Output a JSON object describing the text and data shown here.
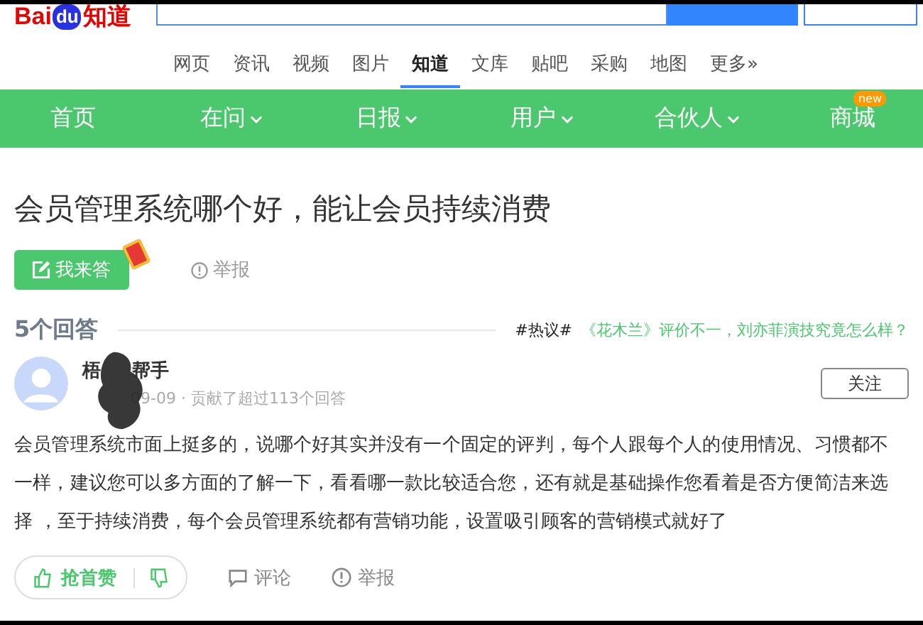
{
  "header": {
    "logo": {
      "part_1": "Bai",
      "part_2": "du",
      "part_3": "知道"
    }
  },
  "channels": [
    {
      "label": "网页",
      "selected": false
    },
    {
      "label": "资讯",
      "selected": false
    },
    {
      "label": "视频",
      "selected": false
    },
    {
      "label": "图片",
      "selected": false
    },
    {
      "label": "知道",
      "selected": true
    },
    {
      "label": "文库",
      "selected": false
    },
    {
      "label": "贴吧",
      "selected": false
    },
    {
      "label": "采购",
      "selected": false
    },
    {
      "label": "地图",
      "selected": false
    },
    {
      "label": "更多»",
      "selected": false
    }
  ],
  "menu": [
    {
      "label": "首页",
      "dropdown": false
    },
    {
      "label": "在问",
      "dropdown": true
    },
    {
      "label": "日报",
      "dropdown": true
    },
    {
      "label": "用户",
      "dropdown": true
    },
    {
      "label": "合伙人",
      "dropdown": true
    },
    {
      "label": "商城",
      "dropdown": false,
      "badge": "new"
    }
  ],
  "question": {
    "title": "会员管理系统哪个好，能让会员持续消费",
    "answer_button": "我来答",
    "report": "举报"
  },
  "answers_header": {
    "count": "5个回答",
    "hot_tag": "#热议#",
    "hot_link": "《花木兰》评价不一，刘亦菲演技究竟怎么样？"
  },
  "answer": {
    "author_start": "梧",
    "author_end": "帮手",
    "meta": "09-09 · 贡献了超过113个回答",
    "follow": "关注",
    "text": "会员管理系统市面上挺多的，说哪个好其实并没有一个固定的评判，每个人跟每个人的使用情况、习惯都不一样，建议您可以多方面的了解一下，看看哪一款比较适合您，还有就是基础操作您看着是否方便简洁来选择 ，至于持续消费，每个会员管理系统都有营销功能，设置吸引顾客的营销模式就好了",
    "like": "抢首赞",
    "comment": "评论",
    "report": "举报"
  }
}
